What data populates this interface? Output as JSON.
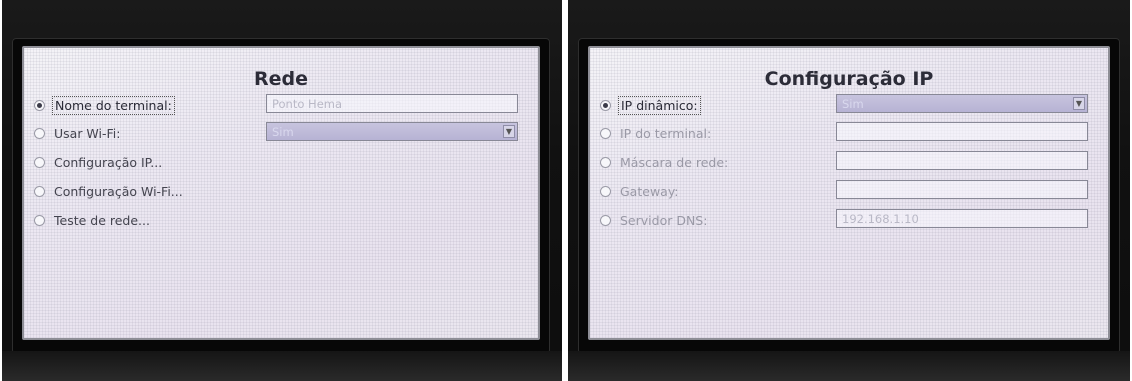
{
  "left_screen": {
    "title": "Rede",
    "items": [
      {
        "label": "Nome do terminal:",
        "selected": true
      },
      {
        "label": "Usar Wi-Fi:",
        "selected": false
      },
      {
        "label": "Configuração IP...",
        "selected": false
      },
      {
        "label": "Configuração Wi-Fi...",
        "selected": false
      },
      {
        "label": "Teste de rede...",
        "selected": false
      }
    ],
    "fields": {
      "terminal_name_value": "Ponto Hema",
      "wifi_value": "Sim"
    }
  },
  "right_screen": {
    "title": "Configuração IP",
    "items": [
      {
        "label": "IP dinâmico:",
        "selected": true
      },
      {
        "label": "IP do terminal:",
        "selected": false
      },
      {
        "label": "Máscara de rede:",
        "selected": false
      },
      {
        "label": "Gateway:",
        "selected": false
      },
      {
        "label": "Servidor DNS:",
        "selected": false
      }
    ],
    "fields": {
      "dynamic_ip_value": "Sim",
      "terminal_ip_value": "",
      "netmask_value": "",
      "gateway_value": "",
      "dns_value": "192.168.1.10"
    }
  },
  "icons": {
    "dropdown_arrow": "chevron-down-icon"
  }
}
